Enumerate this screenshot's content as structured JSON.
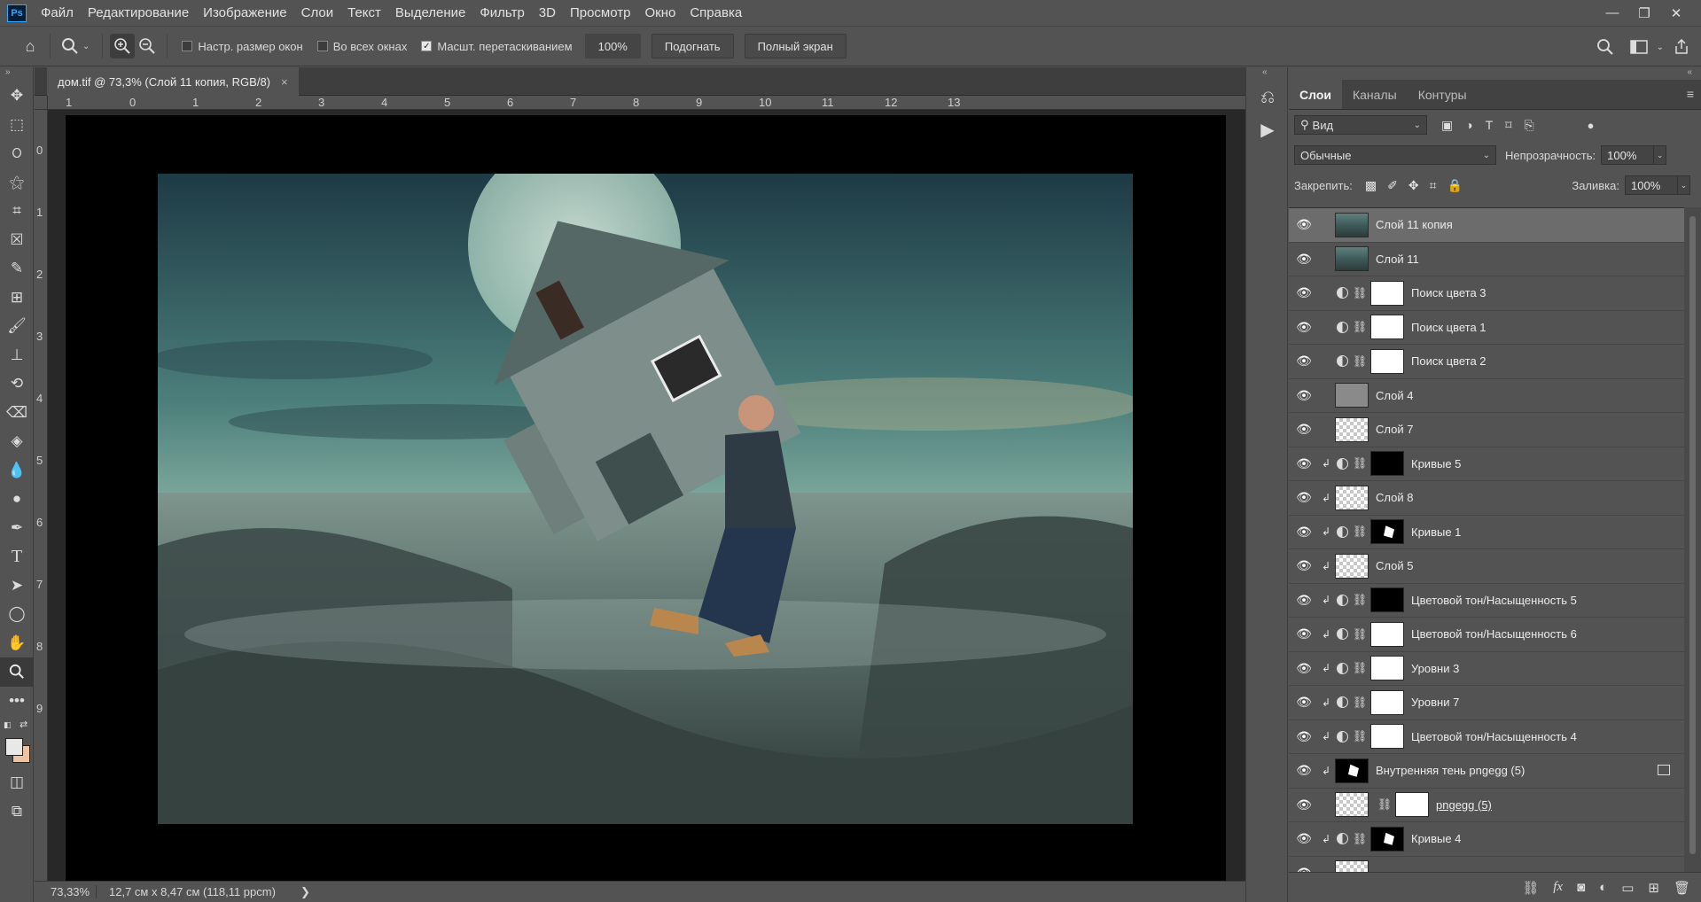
{
  "menu": {
    "items": [
      "Файл",
      "Редактирование",
      "Изображение",
      "Слои",
      "Текст",
      "Выделение",
      "Фильтр",
      "3D",
      "Просмотр",
      "Окно",
      "Справка"
    ],
    "logo": "Ps"
  },
  "options": {
    "resize_windows": "Настр. размер окон",
    "all_windows": "Во всех окнах",
    "scrubby_zoom": "Масшт. перетаскиванием",
    "zoom_value": "100%",
    "fit_button": "Подогнать",
    "fullscreen_button": "Полный экран"
  },
  "document": {
    "tab_title": "дом.tif @ 73,3% (Слой 11 копия, RGB/8)",
    "ruler_h": [
      "1",
      "0",
      "1",
      "2",
      "3",
      "4",
      "5",
      "6",
      "7",
      "8",
      "9",
      "10",
      "11",
      "12",
      "13"
    ],
    "ruler_v": [
      "0",
      "1",
      "2",
      "3",
      "4",
      "5",
      "6",
      "7",
      "8",
      "9"
    ]
  },
  "status": {
    "zoom": "73,33%",
    "info": "12,7 см x 8,47 см (118,11 ppcm)",
    "arrow": "❯"
  },
  "panel": {
    "tabs": [
      "Слои",
      "Каналы",
      "Контуры"
    ],
    "filter_kind": "Вид",
    "blend_mode": "Обычные",
    "opacity_label": "Непрозрачность:",
    "opacity_value": "100%",
    "lock_label": "Закрепить:",
    "fill_label": "Заливка:",
    "fill_value": "100%"
  },
  "layers": [
    {
      "name": "Слой 11 копия",
      "thumb": "img",
      "selected": true
    },
    {
      "name": "Слой 11",
      "thumb": "img"
    },
    {
      "name": "Поиск цвета 3",
      "adjustment": true,
      "mask": "white"
    },
    {
      "name": "Поиск цвета 1",
      "adjustment": true,
      "mask": "white"
    },
    {
      "name": "Поиск цвета 2",
      "adjustment": true,
      "mask": "white"
    },
    {
      "name": "Слой 4",
      "thumb": "gray"
    },
    {
      "name": "Слой 7",
      "thumb": "checker"
    },
    {
      "name": "Кривые 5",
      "clipped": true,
      "adjustment": true,
      "mask": "black"
    },
    {
      "name": "Слой 8",
      "clipped": true,
      "thumb": "checker"
    },
    {
      "name": "Кривые 1",
      "clipped": true,
      "adjustment": true,
      "mask": "blackshape"
    },
    {
      "name": "Слой 5",
      "clipped": true,
      "thumb": "checker"
    },
    {
      "name": "Цветовой тон/Насыщенность 5",
      "clipped": true,
      "adjustment": true,
      "mask": "black"
    },
    {
      "name": "Цветовой тон/Насыщенность 6",
      "clipped": true,
      "adjustment": true,
      "mask": "white"
    },
    {
      "name": "Уровни 3",
      "clipped": true,
      "adjustment": true,
      "mask": "white"
    },
    {
      "name": "Уровни 7",
      "clipped": true,
      "adjustment": true,
      "mask": "white"
    },
    {
      "name": "Цветовой тон/Насыщенность 4",
      "clipped": true,
      "adjustment": true,
      "mask": "white"
    },
    {
      "name": "Внутренняя тень pngegg (5)",
      "clipped": true,
      "thumb": "blackshape",
      "fx": true
    },
    {
      "name": "pngegg (5)",
      "thumb": "checker",
      "mask": "white",
      "underline": true
    },
    {
      "name": "Кривые 4",
      "clipped": true,
      "adjustment": true,
      "mask": "blackshape"
    },
    {
      "name": "",
      "thumb": "checker"
    }
  ],
  "colors": {
    "ui_bg": "#535353",
    "canvas_bg": "#282828",
    "selected_layer": "#6c6c6c",
    "background_swatch": "#f0c3a0"
  }
}
